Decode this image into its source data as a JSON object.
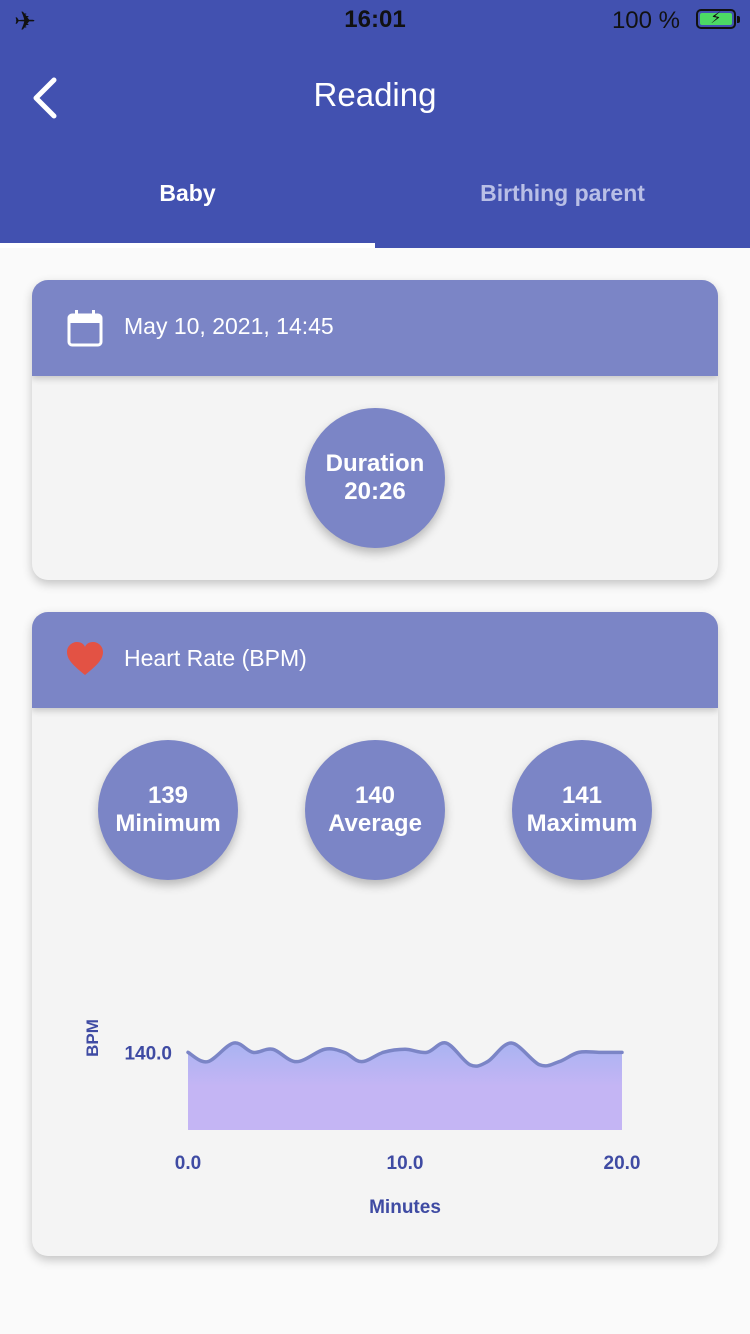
{
  "status_bar": {
    "time": "16:01",
    "battery": "100 %"
  },
  "header": {
    "title": "Reading"
  },
  "tabs": [
    {
      "label": "Baby",
      "active": true
    },
    {
      "label": "Birthing parent",
      "active": false
    }
  ],
  "session_card": {
    "datetime": "May 10, 2021, 14:45",
    "duration_label": "Duration",
    "duration_value": "20:26"
  },
  "heart_card": {
    "title": "Heart Rate (BPM)",
    "stats": [
      {
        "value": "139",
        "label": "Minimum"
      },
      {
        "value": "140",
        "label": "Average"
      },
      {
        "value": "141",
        "label": "Maximum"
      }
    ]
  },
  "chart_data": {
    "type": "area",
    "xlabel": "Minutes",
    "ylabel": "BPM",
    "x_ticks": [
      "0.0",
      "10.0",
      "20.0"
    ],
    "y_ticks": [
      "140.0"
    ],
    "xlim": [
      0,
      20
    ],
    "ylim": [
      137.5,
      141.3
    ],
    "x": [
      0,
      0.9,
      2.1,
      3.0,
      3.9,
      5.0,
      6.3,
      7.2,
      8.0,
      9.0,
      10.0,
      11.0,
      11.9,
      13.0,
      13.8,
      14.9,
      16.2,
      17.1,
      18.0,
      19.0,
      20.0
    ],
    "values": [
      140.0,
      139.7,
      140.3,
      140.0,
      140.1,
      139.7,
      140.1,
      140.0,
      139.7,
      140.0,
      140.1,
      140.0,
      140.3,
      139.6,
      139.7,
      140.3,
      139.6,
      139.7,
      140.0,
      140.0,
      140.0
    ],
    "colors": {
      "line": "#7b85c6",
      "fill_top": "#a9b3f2",
      "fill_bottom": "#c4b5f4",
      "text": "#3f4ba3"
    }
  }
}
